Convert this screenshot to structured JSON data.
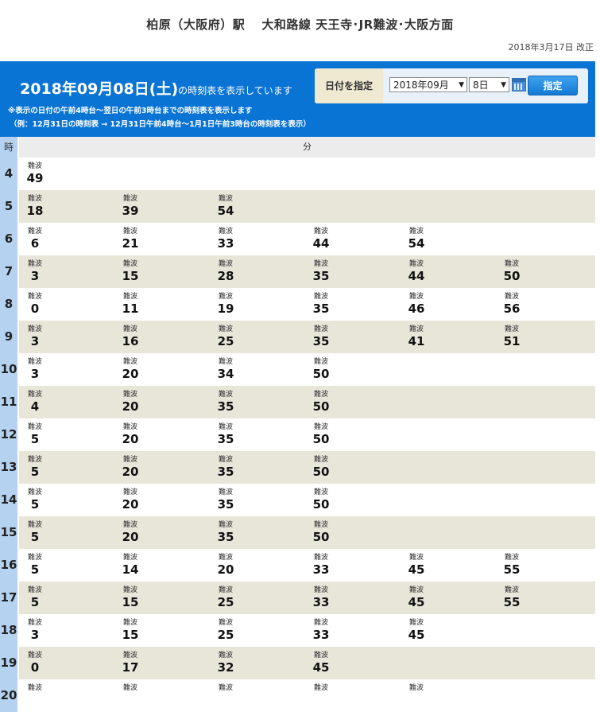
{
  "header": {
    "title": "柏原（大阪府）駅　 大和路線  天王寺･JR難波･大阪方面",
    "revised": "2018年3月17日  改正"
  },
  "banner": {
    "date_text": "2018年09月08日(土)",
    "suffix": "の時刻表を表示しています",
    "note1": "※表示の日付の午前4時台～翌日の午前3時台までの時刻表を表示します",
    "note2": "（例：12月31日の時刻表  →  12月31日午前4時台～1月1日午前3時台の時刻表を表示）",
    "date_label": "日付を指定",
    "month_select": "2018年09月",
    "day_select": "8日",
    "set_button": "指定"
  },
  "table": {
    "hour_header": "時",
    "minute_header": "分",
    "rows": [
      {
        "hour": "4",
        "trains": [
          {
            "dest": "難波",
            "min": "49"
          }
        ]
      },
      {
        "hour": "5",
        "trains": [
          {
            "dest": "難波",
            "min": "18"
          },
          {
            "dest": "難波",
            "min": "39"
          },
          {
            "dest": "難波",
            "min": "54"
          }
        ]
      },
      {
        "hour": "6",
        "trains": [
          {
            "dest": "難波",
            "min": "6"
          },
          {
            "dest": "難波",
            "min": "21"
          },
          {
            "dest": "難波",
            "min": "33"
          },
          {
            "dest": "難波",
            "min": "44"
          },
          {
            "dest": "難波",
            "min": "54"
          }
        ]
      },
      {
        "hour": "7",
        "trains": [
          {
            "dest": "難波",
            "min": "3"
          },
          {
            "dest": "難波",
            "min": "15"
          },
          {
            "dest": "難波",
            "min": "28"
          },
          {
            "dest": "難波",
            "min": "35"
          },
          {
            "dest": "難波",
            "min": "44"
          },
          {
            "dest": "難波",
            "min": "50"
          }
        ]
      },
      {
        "hour": "8",
        "trains": [
          {
            "dest": "難波",
            "min": "0"
          },
          {
            "dest": "難波",
            "min": "11"
          },
          {
            "dest": "難波",
            "min": "19"
          },
          {
            "dest": "難波",
            "min": "35"
          },
          {
            "dest": "難波",
            "min": "46"
          },
          {
            "dest": "難波",
            "min": "56"
          }
        ]
      },
      {
        "hour": "9",
        "trains": [
          {
            "dest": "難波",
            "min": "3"
          },
          {
            "dest": "難波",
            "min": "16"
          },
          {
            "dest": "難波",
            "min": "25"
          },
          {
            "dest": "難波",
            "min": "35"
          },
          {
            "dest": "難波",
            "min": "41"
          },
          {
            "dest": "難波",
            "min": "51"
          }
        ]
      },
      {
        "hour": "10",
        "trains": [
          {
            "dest": "難波",
            "min": "3"
          },
          {
            "dest": "難波",
            "min": "20"
          },
          {
            "dest": "難波",
            "min": "34"
          },
          {
            "dest": "難波",
            "min": "50"
          }
        ]
      },
      {
        "hour": "11",
        "trains": [
          {
            "dest": "難波",
            "min": "4"
          },
          {
            "dest": "難波",
            "min": "20"
          },
          {
            "dest": "難波",
            "min": "35"
          },
          {
            "dest": "難波",
            "min": "50"
          }
        ]
      },
      {
        "hour": "12",
        "trains": [
          {
            "dest": "難波",
            "min": "5"
          },
          {
            "dest": "難波",
            "min": "20"
          },
          {
            "dest": "難波",
            "min": "35"
          },
          {
            "dest": "難波",
            "min": "50"
          }
        ]
      },
      {
        "hour": "13",
        "trains": [
          {
            "dest": "難波",
            "min": "5"
          },
          {
            "dest": "難波",
            "min": "20"
          },
          {
            "dest": "難波",
            "min": "35"
          },
          {
            "dest": "難波",
            "min": "50"
          }
        ]
      },
      {
        "hour": "14",
        "trains": [
          {
            "dest": "難波",
            "min": "5"
          },
          {
            "dest": "難波",
            "min": "20"
          },
          {
            "dest": "難波",
            "min": "35"
          },
          {
            "dest": "難波",
            "min": "50"
          }
        ]
      },
      {
        "hour": "15",
        "trains": [
          {
            "dest": "難波",
            "min": "5"
          },
          {
            "dest": "難波",
            "min": "20"
          },
          {
            "dest": "難波",
            "min": "35"
          },
          {
            "dest": "難波",
            "min": "50"
          }
        ]
      },
      {
        "hour": "16",
        "trains": [
          {
            "dest": "難波",
            "min": "5"
          },
          {
            "dest": "難波",
            "min": "14"
          },
          {
            "dest": "難波",
            "min": "20"
          },
          {
            "dest": "難波",
            "min": "33"
          },
          {
            "dest": "難波",
            "min": "45"
          },
          {
            "dest": "難波",
            "min": "55"
          }
        ]
      },
      {
        "hour": "17",
        "trains": [
          {
            "dest": "難波",
            "min": "5"
          },
          {
            "dest": "難波",
            "min": "15"
          },
          {
            "dest": "難波",
            "min": "25"
          },
          {
            "dest": "難波",
            "min": "33"
          },
          {
            "dest": "難波",
            "min": "45"
          },
          {
            "dest": "難波",
            "min": "55"
          }
        ]
      },
      {
        "hour": "18",
        "trains": [
          {
            "dest": "難波",
            "min": "3"
          },
          {
            "dest": "難波",
            "min": "15"
          },
          {
            "dest": "難波",
            "min": "25"
          },
          {
            "dest": "難波",
            "min": "33"
          },
          {
            "dest": "難波",
            "min": "45"
          }
        ]
      },
      {
        "hour": "19",
        "trains": [
          {
            "dest": "難波",
            "min": "0"
          },
          {
            "dest": "難波",
            "min": "17"
          },
          {
            "dest": "難波",
            "min": "32"
          },
          {
            "dest": "難波",
            "min": "45"
          }
        ]
      },
      {
        "hour": "20",
        "trains": [
          {
            "dest": "難波",
            "min": ""
          },
          {
            "dest": "難波",
            "min": ""
          },
          {
            "dest": "難波",
            "min": ""
          },
          {
            "dest": "難波",
            "min": ""
          },
          {
            "dest": "難波",
            "min": ""
          }
        ]
      }
    ]
  },
  "colors": {
    "banner_blue": "#0a74d4",
    "hour_column": "#b5d3f1",
    "alt_row": "#e8e6d9"
  }
}
